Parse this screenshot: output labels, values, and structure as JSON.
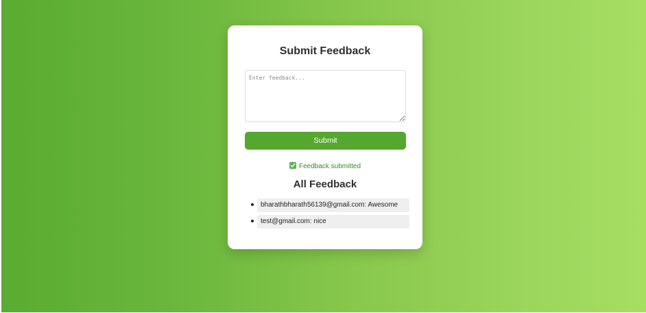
{
  "form": {
    "title": "Submit Feedback",
    "textarea_placeholder": "Enter feedback...",
    "textarea_value": "",
    "submit_label": "Submit"
  },
  "status": {
    "icon": "check-box-icon",
    "text": "Feedback submitted",
    "color": "#3a8a25"
  },
  "feedback": {
    "title": "All Feedback",
    "items": [
      {
        "text": "bharathbharath56139@gmail.com: Awesome"
      },
      {
        "text": "test@gmail.com: nice"
      }
    ]
  },
  "colors": {
    "gradient_start": "#5aab31",
    "gradient_end": "#a6de62",
    "button": "#55a72f"
  }
}
